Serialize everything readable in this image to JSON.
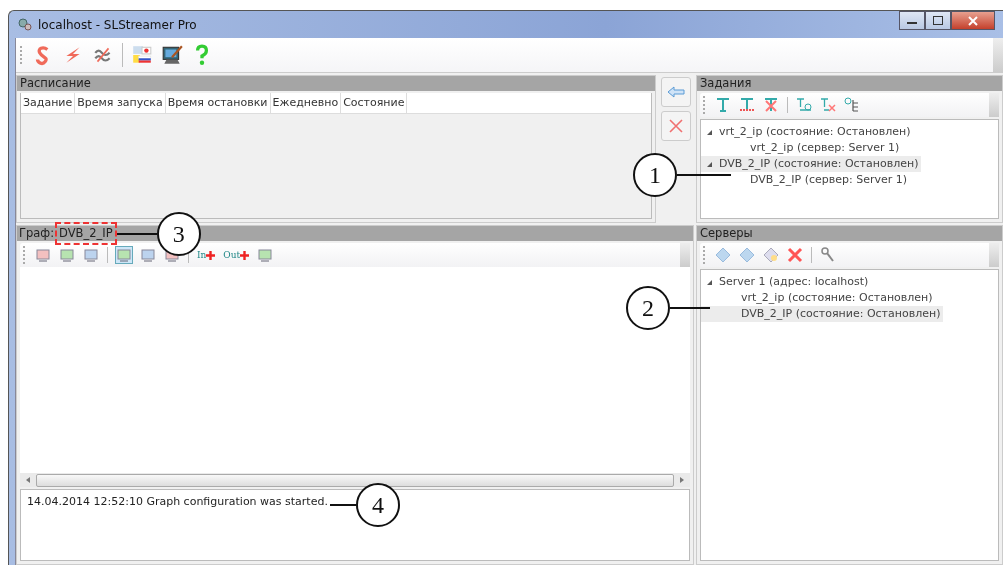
{
  "window": {
    "title": "localhost - SLStreamer Pro"
  },
  "schedule": {
    "title": "Расписание",
    "columns": [
      "Задание",
      "Время запуска",
      "Время остановки",
      "Ежедневно",
      "Состояние"
    ]
  },
  "graph": {
    "label": "Граф:",
    "name": "DVB_2_IP",
    "tools": [
      {
        "kind": "icon"
      },
      {
        "kind": "icon"
      },
      {
        "kind": "icon"
      },
      {
        "kind": "sep"
      },
      {
        "kind": "icon",
        "selected": true
      },
      {
        "kind": "icon",
        "selected": false
      },
      {
        "kind": "icon",
        "selected": false
      },
      {
        "kind": "sep"
      },
      {
        "kind": "port",
        "text": "In"
      },
      {
        "kind": "port",
        "text": "Out"
      },
      {
        "kind": "icon"
      }
    ],
    "log": "14.04.2014 12:52:10 Graph configuration was started."
  },
  "tasks": {
    "title": "Задания",
    "items": [
      {
        "text": "vrt_2_ip (состояние: Остановлен)",
        "expanded": true,
        "selected": false,
        "children": [
          {
            "text": "vrt_2_ip (сервер: Server 1)",
            "selected": false
          }
        ]
      },
      {
        "text": "DVB_2_IP (состояние: Остановлен)",
        "expanded": true,
        "selected": true,
        "children": [
          {
            "text": "DVB_2_IP (сервер: Server 1)",
            "selected": false
          }
        ]
      }
    ]
  },
  "servers": {
    "title": "Серверы",
    "items": [
      {
        "text": "Server 1 (адрес: localhost)",
        "expanded": true,
        "selected": false,
        "children": [
          {
            "text": "vrt_2_ip (состояние: Остановлен)",
            "selected": false
          },
          {
            "text": "DVB_2_IP (состояние: Остановлен)",
            "selected": true
          }
        ]
      }
    ]
  },
  "callouts": [
    "1",
    "2",
    "3",
    "4"
  ]
}
